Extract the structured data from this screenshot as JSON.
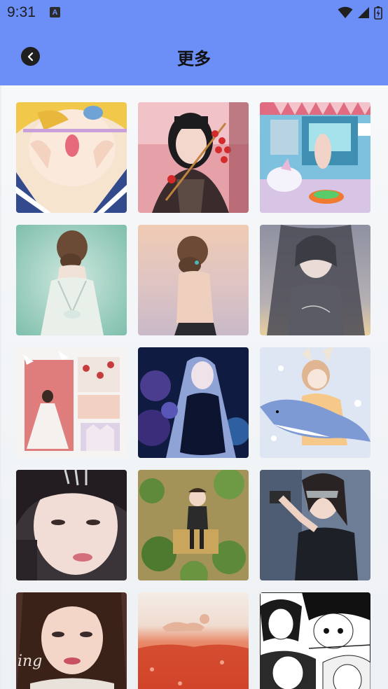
{
  "status_bar": {
    "time": "9:31",
    "badge": "A",
    "icons": [
      "wifi-icon",
      "signal-icon",
      "battery-icon"
    ]
  },
  "header": {
    "title": "更多",
    "back_icon": "back-arrow-icon"
  },
  "colors": {
    "header_bg": "#6c8ef7",
    "content_bg": "#f2f4f7"
  },
  "gallery": {
    "items": [
      {
        "name": "sailor-girl-pocky"
      },
      {
        "name": "girl-candied-haws"
      },
      {
        "name": "pool-unicorn-girl"
      },
      {
        "name": "bride-back-mint"
      },
      {
        "name": "girl-back-sunset"
      },
      {
        "name": "grey-hair-girl"
      },
      {
        "name": "wedding-collage"
      },
      {
        "name": "blue-hair-girl-flowers"
      },
      {
        "name": "bunny-girl-shark"
      },
      {
        "name": "portrait-girl-tiara"
      },
      {
        "name": "girl-sitting-ivy"
      },
      {
        "name": "girl-with-gun"
      },
      {
        "name": "portrait-girl-ing"
      },
      {
        "name": "cat-red-field"
      },
      {
        "name": "manga-girls"
      }
    ],
    "overlay_text_tile13": "ing"
  }
}
